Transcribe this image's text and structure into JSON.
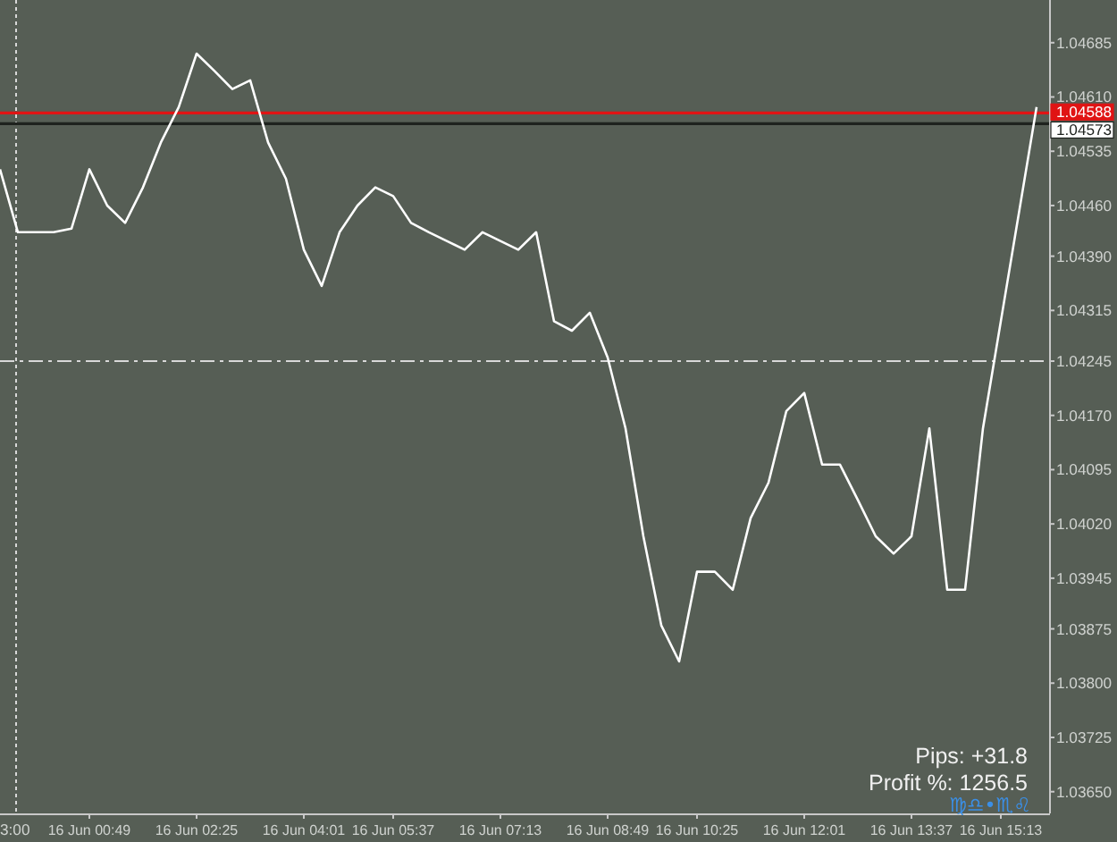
{
  "chart": {
    "chart_data": {
      "type": "line",
      "ylim": [
        1.0362,
        1.04744
      ],
      "categories": [
        null,
        null,
        null,
        null,
        null,
        "16 Jun 00:49",
        null,
        null,
        null,
        null,
        null,
        "16 Jun 02:25",
        null,
        null,
        null,
        null,
        null,
        "16 Jun 04:01",
        null,
        null,
        null,
        null,
        "16 Jun 05:37",
        null,
        null,
        null,
        null,
        null,
        "16 Jun 07:13",
        null,
        null,
        null,
        null,
        null,
        "16 Jun 08:49",
        null,
        null,
        null,
        null,
        "16 Jun 10:25",
        null,
        null,
        null,
        null,
        null,
        "16 Jun 12:01",
        null,
        null,
        null,
        null,
        null,
        "16 Jun 13:37",
        null,
        null,
        null,
        null,
        "16 Jun 15:13",
        null,
        null
      ],
      "yticks": [
        {
          "value": 1.04685,
          "label": "1.04685"
        },
        {
          "value": 1.0461,
          "label": "1.04610"
        },
        {
          "value": 1.04535,
          "label": "1.04535"
        },
        {
          "value": 1.0446,
          "label": "1.04460"
        },
        {
          "value": 1.0439,
          "label": "1.04390"
        },
        {
          "value": 1.04315,
          "label": "1.04315"
        },
        {
          "value": 1.04245,
          "label": "1.04245"
        },
        {
          "value": 1.0417,
          "label": "1.04170"
        },
        {
          "value": 1.04095,
          "label": "1.04095"
        },
        {
          "value": 1.0402,
          "label": "1.04020"
        },
        {
          "value": 1.03945,
          "label": "1.03945"
        },
        {
          "value": 1.03875,
          "label": "1.03875"
        },
        {
          "value": 1.038,
          "label": "1.03800"
        },
        {
          "value": 1.03725,
          "label": "1.03725"
        },
        {
          "value": 1.0365,
          "label": "1.03650"
        }
      ],
      "series": [
        {
          "color": "#ffffff",
          "values": [
            1.0451,
            1.04423,
            1.04423,
            1.04423,
            1.04428,
            1.0451,
            1.0446,
            1.04436,
            1.04485,
            1.04547,
            1.04596,
            1.0467,
            1.04646,
            1.04621,
            1.04633,
            1.04547,
            1.04497,
            1.04399,
            1.04349,
            1.04423,
            1.0446,
            1.04485,
            1.04473,
            1.04436,
            1.04423,
            1.04411,
            1.04399,
            1.04423,
            1.04411,
            1.04399,
            1.04423,
            1.043,
            1.04287,
            1.04312,
            1.0425,
            1.04152,
            1.04003,
            1.0388,
            1.0383,
            1.03954,
            1.03954,
            1.03929,
            1.04028,
            1.04077,
            1.04176,
            1.04201,
            1.04102,
            1.04102,
            1.04053,
            1.04003,
            1.03979,
            1.04003,
            1.04152,
            1.03929,
            1.03929,
            1.04152,
            1.043,
            1.04448,
            1.04596
          ]
        }
      ],
      "ref_lines": [
        {
          "axis": "y",
          "value": 1.04588,
          "label": "1.04588",
          "color": "#e01414"
        },
        {
          "axis": "y",
          "value": 1.04573,
          "label": "1.04573",
          "color": "#1e221e"
        },
        {
          "axis": "y",
          "value": 1.04245,
          "color": "#d8d8d8"
        }
      ]
    },
    "left_edge_time": "3:00",
    "pips": "Pips: +31.8",
    "profit": "Profit %: 1256.5",
    "signs": "♍♎•♏♌"
  }
}
